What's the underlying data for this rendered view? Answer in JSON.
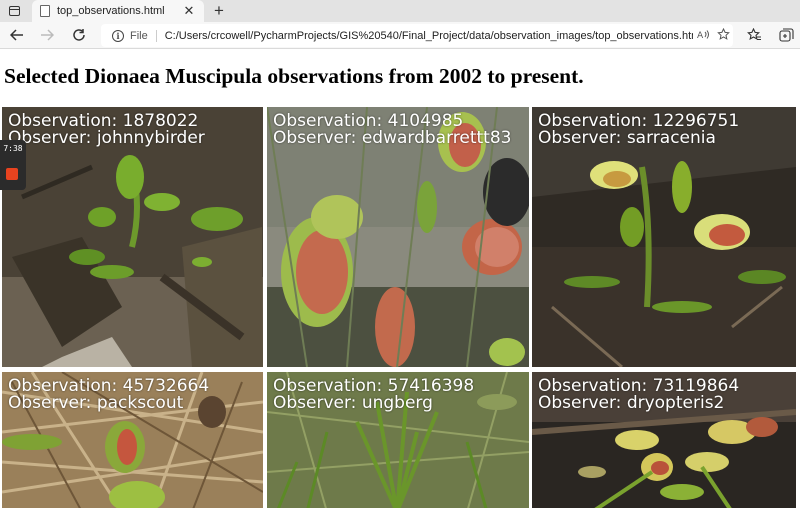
{
  "browser": {
    "tab_title": "top_observations.html",
    "tab_close": "✕",
    "new_tab": "+",
    "address_scheme": "File",
    "address_url": "C:/Users/crcowell/PycharmProjects/GIS%20540/Final_Project/data/observation_images/top_observations.html",
    "icons": {
      "window": "window-icon",
      "back": "back-arrow-icon",
      "forward": "forward-arrow-icon",
      "refresh": "refresh-icon",
      "info": "info-icon",
      "read_aloud": "read-aloud-icon",
      "favorite": "add-favorite-icon",
      "favorites": "favorites-icon",
      "collections": "collections-icon"
    }
  },
  "page": {
    "title": "Selected Dionaea Muscipula observations from 2002 to present.",
    "observations": [
      {
        "observation": "Observation: 1878022",
        "observer": "Observer: johnnybirder"
      },
      {
        "observation": "Observation: 4104985",
        "observer": "Observer: edwardbarrettt83"
      },
      {
        "observation": "Observation: 12296751",
        "observer": "Observer: sarracenia"
      },
      {
        "observation": "Observation: 45732664",
        "observer": "Observer: packscout"
      },
      {
        "observation": "Observation: 57416398",
        "observer": "Observer: ungberg"
      },
      {
        "observation": "Observation: 73119864",
        "observer": "Observer: dryopteris2"
      }
    ]
  },
  "overlay": {
    "recording_time": "7:38"
  },
  "colors": {
    "trap_green": "#8fbf3a",
    "trap_red": "#b3443a",
    "soil": "#3d3528",
    "pine_straw": "#a88a5a"
  }
}
